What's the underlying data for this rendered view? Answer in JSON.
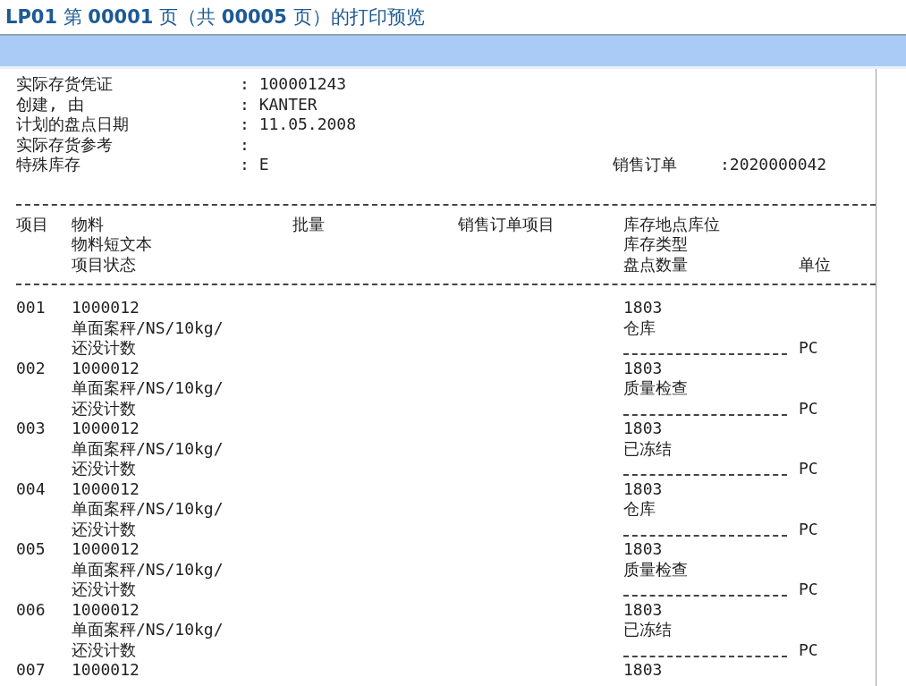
{
  "title": "**LP01** 第 **00001** 页（共 **00005** 页）的打印预览",
  "header_fields": [
    {
      "label": "实际存货凭证",
      "value": ": 100001243"
    },
    {
      "label": "创建, 由",
      "value": ": KANTER"
    },
    {
      "label": "计划的盘点日期",
      "value": ": 11.05.2008"
    },
    {
      "label": "实际存货参考",
      "value": ":"
    },
    {
      "label": "特殊库存",
      "value": ": E"
    }
  ],
  "sales_order": {
    "label": "销售订单",
    "value": ":2020000042"
  },
  "columns": [
    {
      "lines": [
        "项目"
      ]
    },
    {
      "lines": [
        "物料",
        "物料短文本",
        "项目状态"
      ]
    },
    {
      "lines": [
        "批量"
      ]
    },
    {
      "lines": [
        "销售订单项目"
      ]
    },
    {
      "lines": [
        "库存地点库位",
        "库存类型",
        "盘点数量"
      ]
    }
  ],
  "unit_heading": "单位",
  "rows": [
    {
      "item": "001",
      "material": "1000012",
      "short_text": "单面案秤/NS/10kg/",
      "status": "还没计数",
      "storage_location": "1803",
      "storage_type": "仓库",
      "unit": "PC"
    },
    {
      "item": "002",
      "material": "1000012",
      "short_text": "单面案秤/NS/10kg/",
      "status": "还没计数",
      "storage_location": "1803",
      "storage_type": "质量检查",
      "unit": "PC"
    },
    {
      "item": "003",
      "material": "1000012",
      "short_text": "单面案秤/NS/10kg/",
      "status": "还没计数",
      "storage_location": "1803",
      "storage_type": "已冻结",
      "unit": "PC"
    },
    {
      "item": "004",
      "material": "1000012",
      "short_text": "单面案秤/NS/10kg/",
      "status": "还没计数",
      "storage_location": "1803",
      "storage_type": "仓库",
      "unit": "PC"
    },
    {
      "item": "005",
      "material": "1000012",
      "short_text": "单面案秤/NS/10kg/",
      "status": "还没计数",
      "storage_location": "1803",
      "storage_type": "质量检查",
      "unit": "PC"
    },
    {
      "item": "006",
      "material": "1000012",
      "short_text": "单面案秤/NS/10kg/",
      "status": "还没计数",
      "storage_location": "1803",
      "storage_type": "已冻结",
      "unit": "PC"
    },
    {
      "item": "007",
      "material": "1000012",
      "storage_location": "1803"
    }
  ]
}
